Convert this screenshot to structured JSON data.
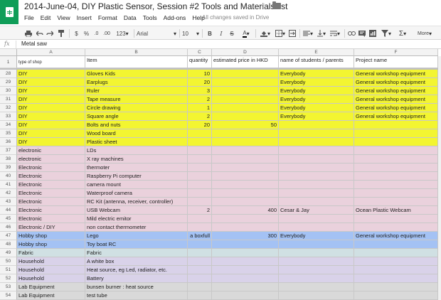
{
  "header": {
    "title": "2014-June-04, DIY Plastic Sensor, Session #2 Tools and Materials list",
    "save_status": "All changes saved in Drive"
  },
  "menu": [
    "File",
    "Edit",
    "View",
    "Insert",
    "Format",
    "Data",
    "Tools",
    "Add-ons",
    "Help"
  ],
  "toolbar": {
    "currency": "$",
    "percent": "%",
    "dec_decrease": ".0",
    "dec_increase": ".00",
    "number_format": "123",
    "font": "Arial",
    "font_size": "10",
    "bold": "B",
    "italic": "I",
    "strike": "S",
    "text_color": "A",
    "more": "More"
  },
  "formula_bar": {
    "fx": "fx",
    "value": "Metal saw"
  },
  "colors": {
    "yellow": "#f3f531",
    "pink": "#ead1dc",
    "blue": "#a4c2f4",
    "teal": "#a2c4c9",
    "green": "#d0e0e3",
    "purple": "#d9d2e9",
    "grey": "#d9d9d9"
  },
  "grid": {
    "columns": [
      "A",
      "B",
      "C",
      "D",
      "E",
      "F"
    ],
    "header_row": {
      "num": "1",
      "cells": [
        "type of shop",
        "Item",
        "quantity",
        "estimated price in HKD",
        "name of students / parents",
        "Project name"
      ]
    },
    "rows": [
      {
        "num": "28",
        "color": "yellow",
        "cells": [
          "DIY",
          "Gloves Kids",
          "10",
          "",
          "Everybody",
          "General workshop equipment"
        ]
      },
      {
        "num": "29",
        "color": "yellow",
        "cells": [
          "DIY",
          "Earplugs",
          "20",
          "",
          "Everybody",
          "General workshop equipment"
        ]
      },
      {
        "num": "30",
        "color": "yellow",
        "cells": [
          "DIY",
          "Ruler",
          "3",
          "",
          "Everybody",
          "General workshop equipment"
        ]
      },
      {
        "num": "31",
        "color": "yellow",
        "cells": [
          "DIY",
          "Tape measure",
          "2",
          "",
          "Everybody",
          "General workshop equipment"
        ]
      },
      {
        "num": "32",
        "color": "yellow",
        "cells": [
          "DIY",
          "Circle drawing",
          "1",
          "",
          "Everybody",
          "General workshop equipment"
        ]
      },
      {
        "num": "33",
        "color": "yellow",
        "cells": [
          "DIY",
          "Square angle",
          "2",
          "",
          "Everybody",
          "General workshop equipment"
        ]
      },
      {
        "num": "34",
        "color": "yellow",
        "cells": [
          "DIY",
          "Bolts and nuts",
          "20",
          "50",
          "",
          ""
        ]
      },
      {
        "num": "35",
        "color": "yellow",
        "cells": [
          "DIY",
          "Wood board",
          "",
          "",
          "",
          ""
        ]
      },
      {
        "num": "36",
        "color": "yellow",
        "cells": [
          "DIY",
          "Plastic sheet",
          "",
          "",
          "",
          ""
        ]
      },
      {
        "num": "37",
        "color": "pink",
        "cells": [
          "electronic",
          "LDs",
          "",
          "",
          "",
          ""
        ]
      },
      {
        "num": "38",
        "color": "pink",
        "cells": [
          "electronic",
          "X ray machines",
          "",
          "",
          "",
          ""
        ]
      },
      {
        "num": "39",
        "color": "pink",
        "cells": [
          "Electronic",
          "thermoter",
          "",
          "",
          "",
          ""
        ]
      },
      {
        "num": "40",
        "color": "pink",
        "cells": [
          "Electronic",
          "Raspberry Pi computer",
          "",
          "",
          "",
          ""
        ]
      },
      {
        "num": "41",
        "color": "pink",
        "cells": [
          "Electronic",
          "camera mount",
          "",
          "",
          "",
          ""
        ]
      },
      {
        "num": "42",
        "color": "pink",
        "cells": [
          "Electronic",
          "Waterproof camera",
          "",
          "",
          "",
          ""
        ]
      },
      {
        "num": "43",
        "color": "pink",
        "cells": [
          "Electronic",
          "RC Kit (antenna, receiver, controller)",
          "",
          "",
          "",
          ""
        ]
      },
      {
        "num": "44",
        "color": "pink",
        "cells": [
          "Electronic",
          "USB Webcam",
          "2",
          "400",
          "Cesar & Jay",
          "Ocean Plastic Webcam"
        ]
      },
      {
        "num": "45",
        "color": "pink",
        "cells": [
          "Electronic",
          "Mild electric emitor",
          "",
          "",
          "",
          ""
        ]
      },
      {
        "num": "46",
        "color": "pink",
        "cells": [
          "Electronic / DIY",
          "non contact thermometer",
          "",
          "",
          "",
          ""
        ]
      },
      {
        "num": "47",
        "color": "blue",
        "cells": [
          "Hobby shop",
          "Lego",
          "a boxfull",
          "300",
          "Everybody",
          "General workshop equipment"
        ]
      },
      {
        "num": "48",
        "color": "blue",
        "cells": [
          "Hobby shop",
          "Toy boat RC",
          "",
          "",
          "",
          ""
        ]
      },
      {
        "num": "49",
        "color": "green",
        "cells": [
          "Fabric",
          "Fabric",
          "",
          "",
          "",
          ""
        ]
      },
      {
        "num": "50",
        "color": "purple",
        "cells": [
          "Household",
          "A white box",
          "",
          "",
          "",
          ""
        ]
      },
      {
        "num": "51",
        "color": "purple",
        "cells": [
          "Household",
          "Heat source, eg Led, radiator, etc.",
          "",
          "",
          "",
          ""
        ]
      },
      {
        "num": "52",
        "color": "purple",
        "cells": [
          "Household",
          "Battery",
          "",
          "",
          "",
          ""
        ]
      },
      {
        "num": "53",
        "color": "grey",
        "cells": [
          "Lab Equipment",
          "bunsen burner : heat source",
          "",
          "",
          "",
          ""
        ]
      },
      {
        "num": "54",
        "color": "grey",
        "cells": [
          "Lab Equipment",
          "test tube",
          "",
          "",
          "",
          ""
        ]
      }
    ]
  }
}
